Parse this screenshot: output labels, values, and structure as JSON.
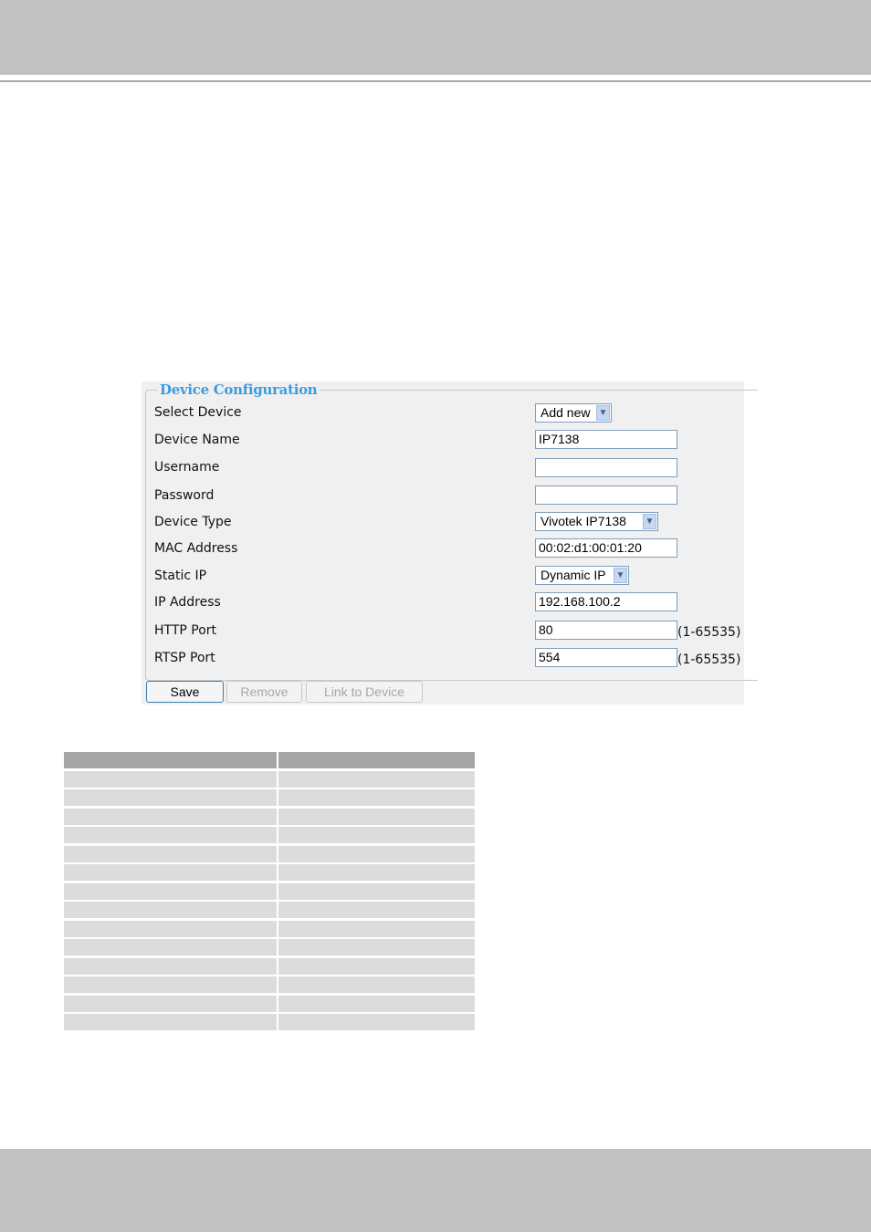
{
  "form": {
    "legend": "Device Configuration",
    "fields": [
      {
        "label": "Select Device",
        "type": "select",
        "value": "Add new"
      },
      {
        "label": "Device Name",
        "type": "text",
        "value": "IP7138"
      },
      {
        "label": "Username",
        "type": "text",
        "value": ""
      },
      {
        "label": "Password",
        "type": "text",
        "value": ""
      },
      {
        "label": "Device Type",
        "type": "select",
        "value": "Vivotek IP7138"
      },
      {
        "label": "MAC Address",
        "type": "text",
        "value": "00:02:d1:00:01:20"
      },
      {
        "label": "Static IP",
        "type": "select",
        "value": "Dynamic IP"
      },
      {
        "label": "IP Address",
        "type": "text",
        "value": "192.168.100.2"
      },
      {
        "label": "HTTP Port",
        "type": "text",
        "value": "80",
        "hint": "(1-65535)"
      },
      {
        "label": "RTSP Port",
        "type": "text",
        "value": "554",
        "hint": "(1-65535)"
      }
    ],
    "buttons": {
      "save": "Save",
      "remove": "Remove",
      "link": "Link to Device"
    }
  },
  "colors": {
    "band": "#c1c1c1",
    "legend": "#3d9be0",
    "table_header": "#a6a6a6",
    "table_row": "#dcdcdc"
  }
}
